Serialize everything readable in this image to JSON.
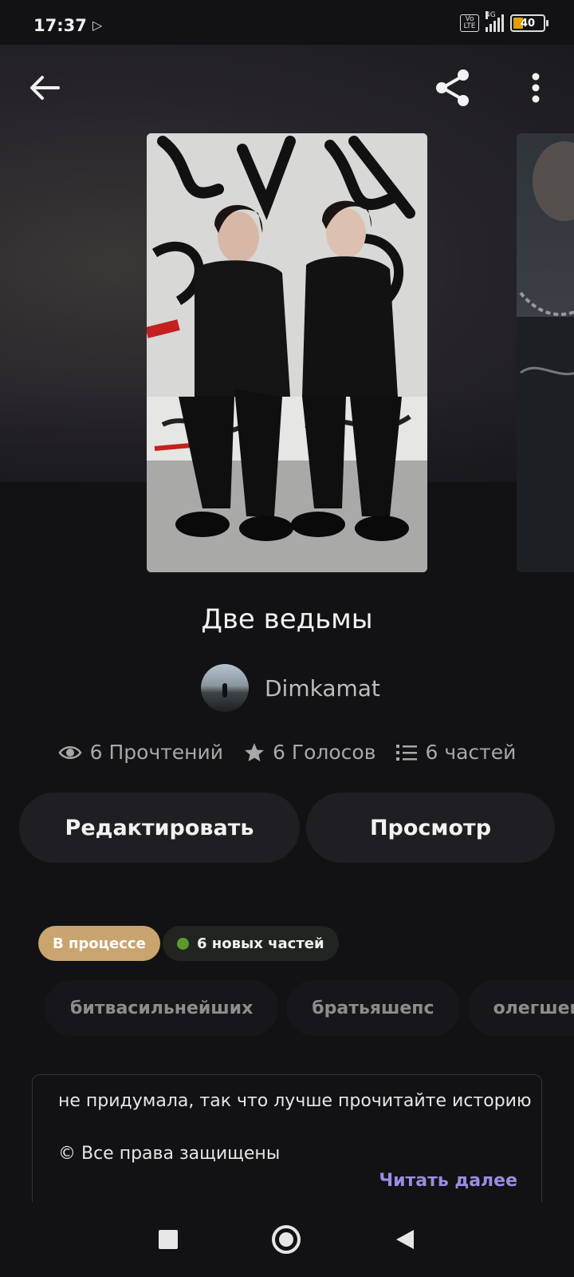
{
  "status_bar": {
    "time": "17:37",
    "network": "4G",
    "volte": "Vo LTE",
    "battery": "40"
  },
  "header": {
    "back_icon": "arrow-left-icon",
    "share_icon": "share-icon",
    "more_icon": "more-vertical-icon"
  },
  "story": {
    "title": "Две ведьмы",
    "author": "Dimkamat",
    "stats": {
      "reads": "6 Прочтений",
      "votes": "6 Голосов",
      "parts": "6 частей"
    }
  },
  "actions": {
    "edit": "Редактировать",
    "view": "Просмотр"
  },
  "badges": {
    "status": "В процессе",
    "new_parts": "6 новых частей",
    "status_color": "#c9a46f",
    "dot_color": "#5a9a2e"
  },
  "tags": [
    "битвасильнейших",
    "братьяшепс",
    "олегшеп"
  ],
  "description": {
    "line1": "не придумала, так что лучше прочитайте историю",
    "line2": "© Все права защищены",
    "read_more": "Читать далее",
    "read_more_color": "#9c8ce0"
  },
  "nav": {
    "recents_icon": "square-icon",
    "home_icon": "circle-home-icon",
    "back_icon": "triangle-back-icon"
  }
}
